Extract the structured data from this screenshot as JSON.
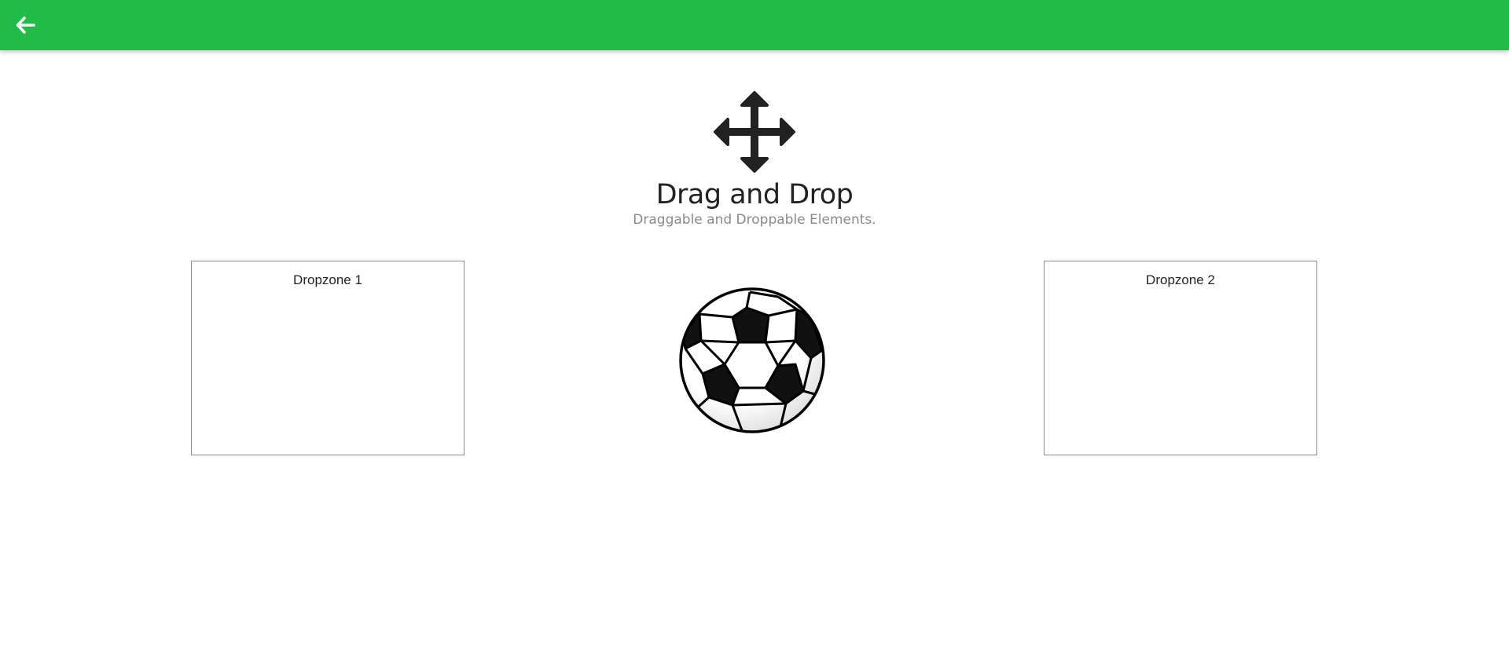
{
  "header": {
    "back_icon": "arrow-left-icon",
    "accent_color": "#21bb48"
  },
  "hero": {
    "icon": "move-arrows-icon",
    "title": "Drag and Drop",
    "subtitle": "Draggable and Droppable Elements."
  },
  "dropzones": [
    {
      "label": "Dropzone 1"
    },
    {
      "label": "Dropzone 2"
    }
  ],
  "draggable": {
    "icon": "soccer-ball-icon"
  }
}
